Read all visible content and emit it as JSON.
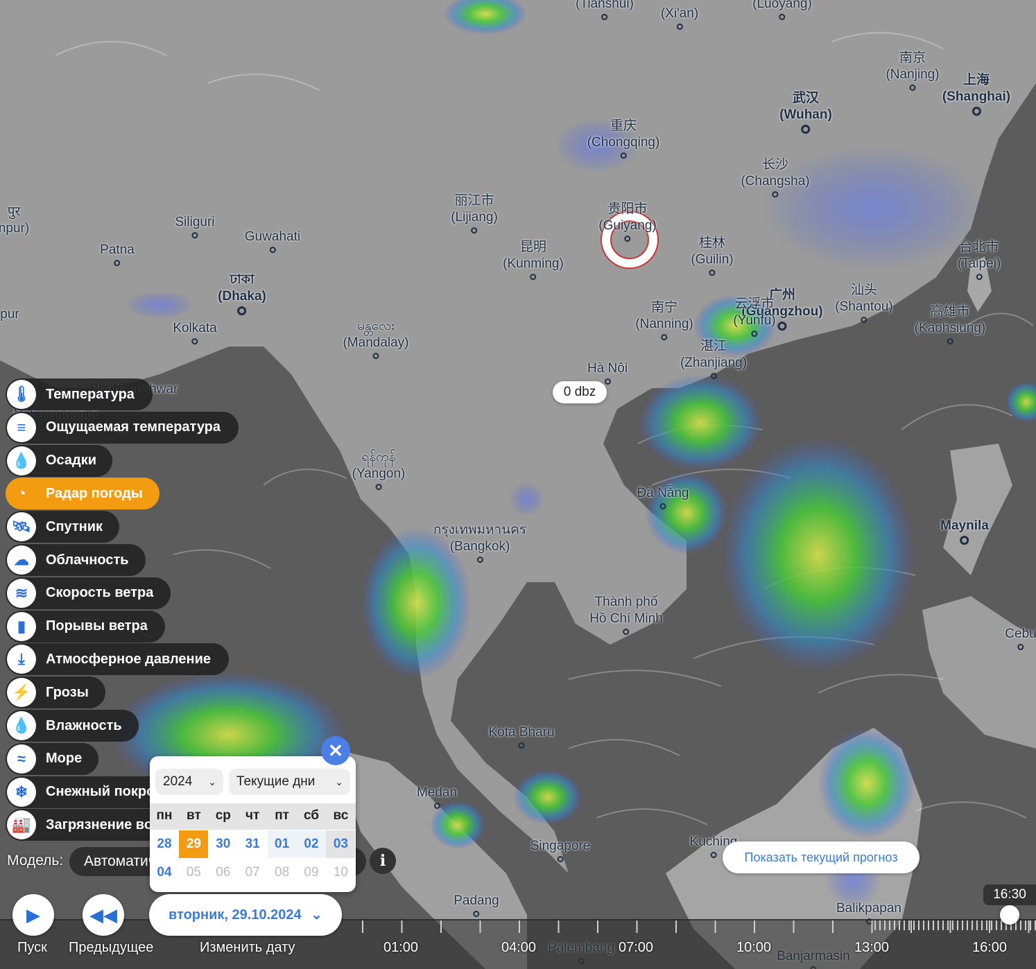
{
  "map": {
    "cities": [
      {
        "id": "tianshui",
        "label": "(Tianshui)",
        "big": false
      },
      {
        "id": "xian",
        "label": "(Xi'an)",
        "big": false
      },
      {
        "id": "luoyang",
        "label": "(Luoyang)",
        "big": false
      },
      {
        "id": "nanjing",
        "label": "南京\n(Nanjing)",
        "big": false
      },
      {
        "id": "shanghai",
        "label": "上海\n(Shanghai)",
        "big": true
      },
      {
        "id": "wuhan",
        "label": "武汉\n(Wuhan)",
        "big": true
      },
      {
        "id": "chongqing",
        "label": "重庆\n(Chongqing)",
        "big": false
      },
      {
        "id": "changsha",
        "label": "长沙\n(Changsha)",
        "big": false
      },
      {
        "id": "lijiang",
        "label": "丽江市\n(Lijiang)",
        "big": false
      },
      {
        "id": "guiyang",
        "label": "贵阳市\n(Guiyang)",
        "big": false
      },
      {
        "id": "kunming",
        "label": "昆明\n(Kunming)",
        "big": false
      },
      {
        "id": "guilin",
        "label": "桂林\n(Guilin)",
        "big": false
      },
      {
        "id": "taipei",
        "label": "台北市\n(Taipei)",
        "big": false
      },
      {
        "id": "shantou",
        "label": "汕头\n(Shantou)",
        "big": false
      },
      {
        "id": "guangzhou",
        "label": "广州\n(Guangzhou)",
        "big": true
      },
      {
        "id": "yunfu",
        "label": "云浮市\n(Yunfu)",
        "big": false
      },
      {
        "id": "kaohsiung",
        "label": "高雄市\n(Kaohsiung)",
        "big": false
      },
      {
        "id": "nanning",
        "label": "南宁\n(Nanning)",
        "big": false
      },
      {
        "id": "zhanjiang",
        "label": "湛江\n(Zhanjiang)",
        "big": false
      },
      {
        "id": "hanoi",
        "label": "Hà Nội",
        "big": false
      },
      {
        "id": "siliguri",
        "label": "Siliguri",
        "big": false
      },
      {
        "id": "guwahati",
        "label": "Guwahati",
        "big": false
      },
      {
        "id": "patna",
        "label": "Patna",
        "big": false
      },
      {
        "id": "dhaka",
        "label": "ঢাকা\n(Dhaka)",
        "big": true
      },
      {
        "id": "kolkata",
        "label": "Kolkata",
        "big": false
      },
      {
        "id": "mandalay",
        "label": "မန္တလေး\n(Mandalay)",
        "big": false
      },
      {
        "id": "bhubaneshwar",
        "label": "Bhubaneshwar",
        "big": false
      },
      {
        "id": "nabarangapur",
        "label": "Nabarangapur",
        "big": false
      },
      {
        "id": "yangon",
        "label": "ရန်ကုန်\n(Yangon)",
        "big": false
      },
      {
        "id": "danang",
        "label": "Đà Nẵng",
        "big": false
      },
      {
        "id": "bangkok",
        "label": "กรุงเทพมหานคร\n(Bangkok)",
        "big": false
      },
      {
        "id": "maynila",
        "label": "Maynila",
        "big": true
      },
      {
        "id": "hcm",
        "label": "Thành phố\nHồ Chí Minh",
        "big": false
      },
      {
        "id": "cebu",
        "label": "Cebu",
        "big": false
      },
      {
        "id": "kotabharu",
        "label": "Kota Bharu",
        "big": false
      },
      {
        "id": "medan",
        "label": "Medan",
        "big": false
      },
      {
        "id": "singapore",
        "label": "Singapore",
        "big": false
      },
      {
        "id": "kuching",
        "label": "Kuching",
        "big": false
      },
      {
        "id": "padang",
        "label": "Padang",
        "big": false
      },
      {
        "id": "balikpapan",
        "label": "Balikpapan",
        "big": false
      },
      {
        "id": "palembang",
        "label": "Palembang",
        "big": false
      },
      {
        "id": "banjarmasin",
        "label": "Banjarmasin",
        "big": false
      },
      {
        "id": "edge_pur",
        "label": "पुर\nnpur)",
        "big": false
      },
      {
        "id": "edge_pur2",
        "label": "pur",
        "big": false
      }
    ],
    "tooltip": "0 dbz"
  },
  "layers": [
    {
      "label": "Температура",
      "icon": "thermometer-icon",
      "glyph": "🌡",
      "active": false
    },
    {
      "label": "Ощущаемая температура",
      "icon": "feels-like-icon",
      "glyph": "≡",
      "active": false
    },
    {
      "label": "Осадки",
      "icon": "raindrop-icon",
      "glyph": "💧",
      "active": false
    },
    {
      "label": "Радар погоды",
      "icon": "radar-icon",
      "glyph": "◔",
      "active": true
    },
    {
      "label": "Спутник",
      "icon": "satellite-icon",
      "glyph": "🛰",
      "active": false
    },
    {
      "label": "Облачность",
      "icon": "cloud-icon",
      "glyph": "☁",
      "active": false
    },
    {
      "label": "Скорость ветра",
      "icon": "wind-icon",
      "glyph": "≋",
      "active": false
    },
    {
      "label": "Порывы ветра",
      "icon": "gusts-icon",
      "glyph": "▮",
      "active": false
    },
    {
      "label": "Атмосферное давление",
      "icon": "pressure-icon",
      "glyph": "⤓",
      "active": false
    },
    {
      "label": "Грозы",
      "icon": "lightning-icon",
      "glyph": "⚡",
      "active": false
    },
    {
      "label": "Влажность",
      "icon": "humidity-icon",
      "glyph": "💧",
      "active": false
    },
    {
      "label": "Море",
      "icon": "waves-icon",
      "glyph": "≈",
      "active": false
    },
    {
      "label": "Снежный покров",
      "icon": "snowflake-icon",
      "glyph": "❄",
      "active": false
    },
    {
      "label": "Загрязнение воздуха",
      "icon": "factory-icon",
      "glyph": "🏭",
      "active": false
    }
  ],
  "model": {
    "label": "Модель:",
    "value": "Автоматически",
    "info": "i"
  },
  "calendar": {
    "year": "2024",
    "range": "Текущие дни",
    "weekdays": [
      "пн",
      "вт",
      "ср",
      "чт",
      "пт",
      "сб",
      "вс"
    ],
    "rows": [
      [
        {
          "d": "28",
          "s": ""
        },
        {
          "d": "29",
          "s": "today"
        },
        {
          "d": "30",
          "s": ""
        },
        {
          "d": "31",
          "s": ""
        },
        {
          "d": "01",
          "s": "next"
        },
        {
          "d": "02",
          "s": "next"
        },
        {
          "d": "03",
          "s": "sun"
        }
      ],
      [
        {
          "d": "04",
          "s": ""
        },
        {
          "d": "05",
          "s": "other"
        },
        {
          "d": "06",
          "s": "other"
        },
        {
          "d": "07",
          "s": "other"
        },
        {
          "d": "08",
          "s": "other"
        },
        {
          "d": "09",
          "s": "other"
        },
        {
          "d": "10",
          "s": "other"
        }
      ]
    ]
  },
  "controls": {
    "play_label": "Пуск",
    "prev_label": "Предыдущее",
    "date_value": "вторник, 29.10.2024",
    "change_date_label": "Изменить дату",
    "current_time": "16:30",
    "show_forecast": "Показать текущий прогноз",
    "ticks": [
      "01:00",
      "04:00",
      "07:00",
      "10:00",
      "13:00",
      "16:00"
    ],
    "progress": 0.974
  },
  "colors": {
    "accent": "#f39c12",
    "link": "#3a7bd5",
    "radar_green": "#43c23a",
    "radar_yellow": "#e4e04a",
    "radar_blue": "#4b6fd6"
  }
}
